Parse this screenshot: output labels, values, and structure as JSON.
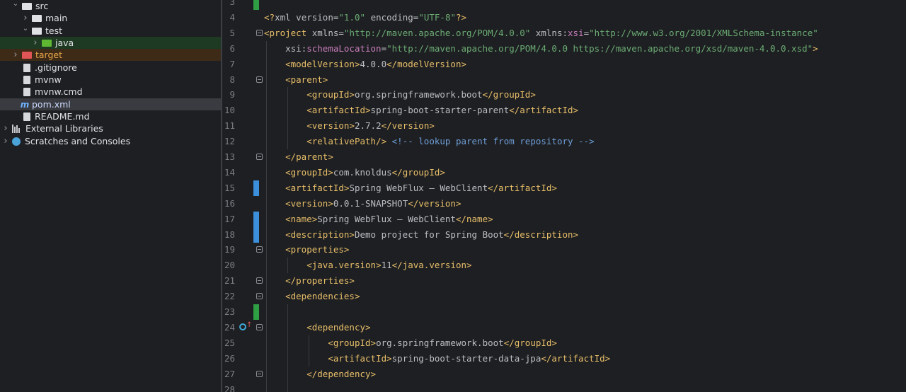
{
  "project_tree": {
    "items": [
      {
        "label": "src",
        "type": "folder",
        "expanded": true,
        "depth": 1
      },
      {
        "label": "main",
        "type": "folder",
        "expanded": false,
        "depth": 2
      },
      {
        "label": "test",
        "type": "folder",
        "expanded": true,
        "depth": 2
      },
      {
        "label": "java",
        "type": "folder-green",
        "expanded": false,
        "depth": 3
      },
      {
        "label": "target",
        "type": "folder-red",
        "expanded": false,
        "depth": 1
      },
      {
        "label": ".gitignore",
        "type": "file",
        "depth": 1
      },
      {
        "label": "mvnw",
        "type": "file",
        "depth": 1
      },
      {
        "label": "mvnw.cmd",
        "type": "file",
        "depth": 1
      },
      {
        "label": "pom.xml",
        "type": "maven",
        "depth": 1,
        "active": true
      },
      {
        "label": "README.md",
        "type": "file",
        "depth": 1
      },
      {
        "label": "External Libraries",
        "type": "libraries",
        "expanded": false,
        "depth": 0
      },
      {
        "label": "Scratches and Consoles",
        "type": "scratches",
        "expanded": false,
        "depth": 0
      }
    ]
  },
  "editor": {
    "lines": [
      {
        "num": "3",
        "text": ""
      },
      {
        "num": "4",
        "text": "<?xml version=\"1.0\" encoding=\"UTF-8\"?>"
      },
      {
        "num": "5",
        "text": "<project xmlns=\"http://maven.apache.org/POM/4.0.0\" xmlns:xsi=\"http://www.w3.org/2001/XMLSchema-instance\""
      },
      {
        "num": "6",
        "text": "    xsi:schemaLocation=\"http://maven.apache.org/POM/4.0.0 https://maven.apache.org/xsd/maven-4.0.0.xsd\">"
      },
      {
        "num": "7",
        "text": "    <modelVersion>4.0.0</modelVersion>"
      },
      {
        "num": "8",
        "text": "    <parent>"
      },
      {
        "num": "9",
        "text": "        <groupId>org.springframework.boot</groupId>"
      },
      {
        "num": "10",
        "text": "        <artifactId>spring-boot-starter-parent</artifactId>"
      },
      {
        "num": "11",
        "text": "        <version>2.7.2</version>"
      },
      {
        "num": "12",
        "text": "        <relativePath/> <!-- lookup parent from repository -->"
      },
      {
        "num": "13",
        "text": "    </parent>"
      },
      {
        "num": "14",
        "text": "    <groupId>com.knoldus</groupId>"
      },
      {
        "num": "15",
        "text": "    <artifactId>Spring WebFlux – WebClient</artifactId>"
      },
      {
        "num": "16",
        "text": "    <version>0.0.1-SNAPSHOT</version>"
      },
      {
        "num": "17",
        "text": "    <name>Spring WebFlux – WebClient</name>"
      },
      {
        "num": "18",
        "text": "    <description>Demo project for Spring Boot</description>"
      },
      {
        "num": "19",
        "text": "    <properties>"
      },
      {
        "num": "20",
        "text": "        <java.version>11</java.version>"
      },
      {
        "num": "21",
        "text": "    </properties>"
      },
      {
        "num": "22",
        "text": "    <dependencies>"
      },
      {
        "num": "23",
        "text": ""
      },
      {
        "num": "24",
        "text": "        <dependency>"
      },
      {
        "num": "25",
        "text": "            <groupId>org.springframework.boot</groupId>"
      },
      {
        "num": "26",
        "text": "            <artifactId>spring-boot-starter-data-jpa</artifactId>"
      },
      {
        "num": "27",
        "text": "        </dependency>"
      },
      {
        "num": "28",
        "text": ""
      }
    ],
    "change_markers": {
      "3": "green",
      "15": "blue",
      "17": "blue",
      "18": "blue",
      "23": "green"
    },
    "fold_lines": [
      "5",
      "8",
      "13",
      "19",
      "21",
      "22",
      "24",
      "27"
    ],
    "gutter_icons": {
      "24": "maven-dependency-icon"
    }
  }
}
